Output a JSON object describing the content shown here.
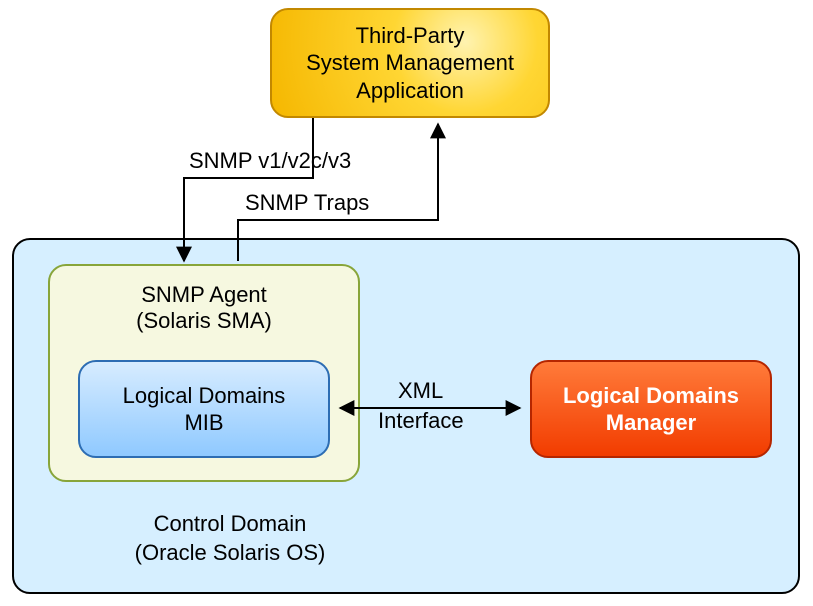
{
  "nodes": {
    "third_party": {
      "line1": "Third-Party",
      "line2": "System Management",
      "line3": "Application"
    },
    "snmp_agent": {
      "line1": "SNMP Agent",
      "line2": "(Solaris SMA)"
    },
    "mib": {
      "line1": "Logical Domains",
      "line2": "MIB"
    },
    "ldm_manager": {
      "line1": "Logical Domains",
      "line2": "Manager"
    },
    "control_domain": {
      "line1": "Control Domain",
      "line2": "(Oracle Solaris OS)"
    }
  },
  "edges": {
    "snmp_versions": "SNMP v1/v2c/v3",
    "snmp_traps": "SNMP Traps",
    "xml": "XML",
    "interface": "Interface"
  }
}
